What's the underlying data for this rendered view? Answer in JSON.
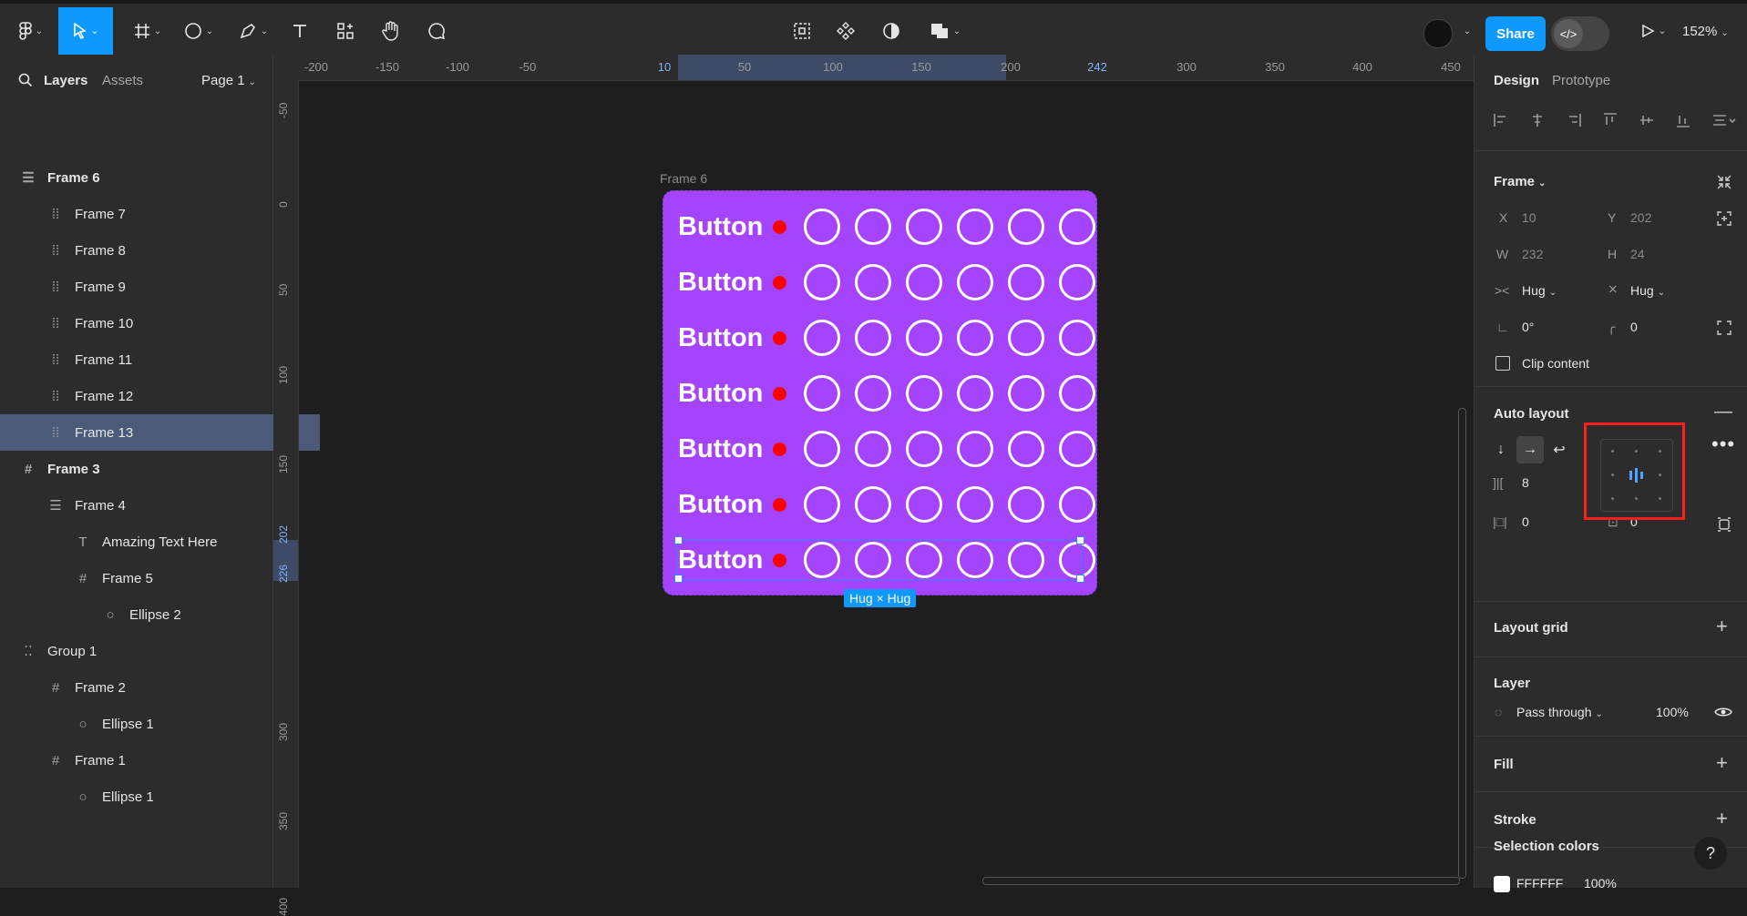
{
  "toolbar": {
    "share_label": "Share",
    "zoom": "152%",
    "dev_mode_icon": "code-icon"
  },
  "left_panel": {
    "tabs": [
      "Layers",
      "Assets"
    ],
    "page_select": "Page 1",
    "layers": [
      {
        "label": "Frame 6",
        "indent": 0,
        "icon": "auto-layout-vertical-icon",
        "bold": true
      },
      {
        "label": "Frame 7",
        "indent": 1,
        "icon": "auto-layout-horizontal-icon"
      },
      {
        "label": "Frame 8",
        "indent": 1,
        "icon": "auto-layout-horizontal-icon"
      },
      {
        "label": "Frame 9",
        "indent": 1,
        "icon": "auto-layout-horizontal-icon"
      },
      {
        "label": "Frame 10",
        "indent": 1,
        "icon": "auto-layout-horizontal-icon"
      },
      {
        "label": "Frame 11",
        "indent": 1,
        "icon": "auto-layout-horizontal-icon"
      },
      {
        "label": "Frame 12",
        "indent": 1,
        "icon": "auto-layout-horizontal-icon"
      },
      {
        "label": "Frame 13",
        "indent": 1,
        "icon": "auto-layout-horizontal-icon",
        "selected": true
      },
      {
        "label": "Frame 3",
        "indent": 0,
        "icon": "frame-icon",
        "bold": true
      },
      {
        "label": "Frame 4",
        "indent": 1,
        "icon": "auto-layout-vertical-icon"
      },
      {
        "label": "Amazing Text Here",
        "indent": 2,
        "icon": "text-icon"
      },
      {
        "label": "Frame 5",
        "indent": 2,
        "icon": "frame-icon"
      },
      {
        "label": "Ellipse 2",
        "indent": 3,
        "icon": "ellipse-icon"
      },
      {
        "label": "Group 1",
        "indent": 0,
        "icon": "group-icon"
      },
      {
        "label": "Frame 2",
        "indent": 1,
        "icon": "frame-icon"
      },
      {
        "label": "Ellipse 1",
        "indent": 2,
        "icon": "ellipse-icon"
      },
      {
        "label": "Frame 1",
        "indent": 1,
        "icon": "frame-icon"
      },
      {
        "label": "Ellipse 1",
        "indent": 2,
        "icon": "ellipse-icon"
      }
    ]
  },
  "rulers": {
    "horizontal": [
      "-200",
      "-150",
      "-100",
      "-50",
      "10",
      "50",
      "100",
      "150",
      "200",
      "242",
      "300",
      "350",
      "400",
      "450"
    ],
    "horizontal_highlight": [
      "10",
      "242"
    ],
    "vertical": [
      "-50",
      "0",
      "50",
      "100",
      "150",
      "202",
      "226",
      "300",
      "350",
      "400"
    ],
    "vertical_highlight": [
      "202",
      "226"
    ]
  },
  "canvas": {
    "frame_label": "Frame 6",
    "button_text": "Button",
    "rows": 7,
    "circles_per_row": 6,
    "hug_badge": "Hug × Hug",
    "colors": {
      "frame_fill": "#a544ff",
      "dot": "#ff0000",
      "selection": "#3b82f6"
    }
  },
  "right_panel": {
    "tabs": [
      "Design",
      "Prototype"
    ],
    "frame_section": {
      "title": "Frame",
      "x_label": "X",
      "x": "10",
      "y_label": "Y",
      "y": "202",
      "w_label": "W",
      "w": "232",
      "h_label": "H",
      "h": "24",
      "width_mode": "Hug",
      "height_mode": "Hug",
      "rotation": "0°",
      "radius": "0",
      "clip_content": "Clip content"
    },
    "auto_layout": {
      "title": "Auto layout",
      "gap": "8",
      "padding_h": "0",
      "padding_v": "0"
    },
    "layout_grid": {
      "title": "Layout grid"
    },
    "layer": {
      "title": "Layer",
      "blend": "Pass through",
      "opacity": "100%"
    },
    "fill": {
      "title": "Fill"
    },
    "stroke": {
      "title": "Stroke"
    },
    "selection_colors": {
      "title": "Selection colors",
      "hex": "FFFFFF",
      "opacity": "100%"
    }
  },
  "help_label": "?"
}
